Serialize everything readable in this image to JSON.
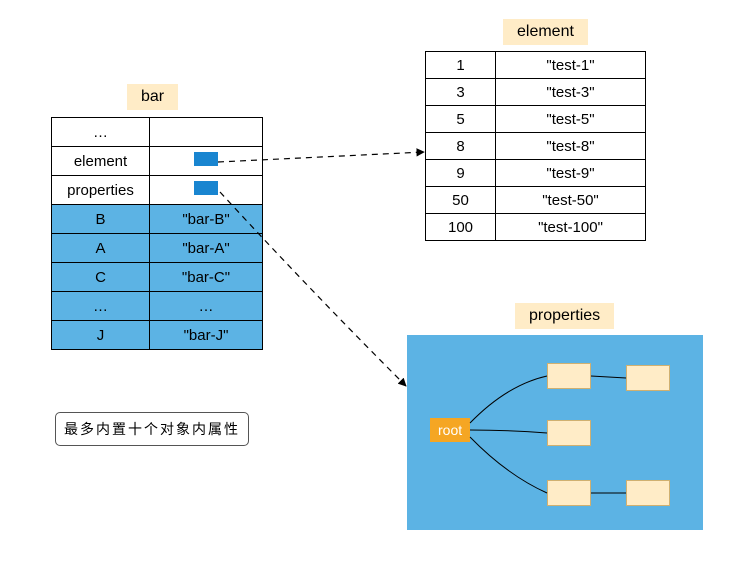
{
  "labels": {
    "bar": "bar",
    "element": "element",
    "properties": "properties"
  },
  "bar_table": {
    "row0_key": "…",
    "row0_val": "",
    "element_key": "element",
    "properties_key": "properties",
    "rows": [
      {
        "key": "B",
        "val": "\"bar-B\""
      },
      {
        "key": "A",
        "val": "\"bar-A\""
      },
      {
        "key": "C",
        "val": "\"bar-C\""
      },
      {
        "key": "…",
        "val": "…"
      },
      {
        "key": "J",
        "val": "\"bar-J\""
      }
    ]
  },
  "element_table": [
    {
      "k": "1",
      "v": "\"test-1\""
    },
    {
      "k": "3",
      "v": "\"test-3\""
    },
    {
      "k": "5",
      "v": "\"test-5\""
    },
    {
      "k": "8",
      "v": "\"test-8\""
    },
    {
      "k": "9",
      "v": "\"test-9\""
    },
    {
      "k": "50",
      "v": "\"test-50\""
    },
    {
      "k": "100",
      "v": "\"test-100\""
    }
  ],
  "caption": "最多内置十个对象内属性",
  "root": "root"
}
